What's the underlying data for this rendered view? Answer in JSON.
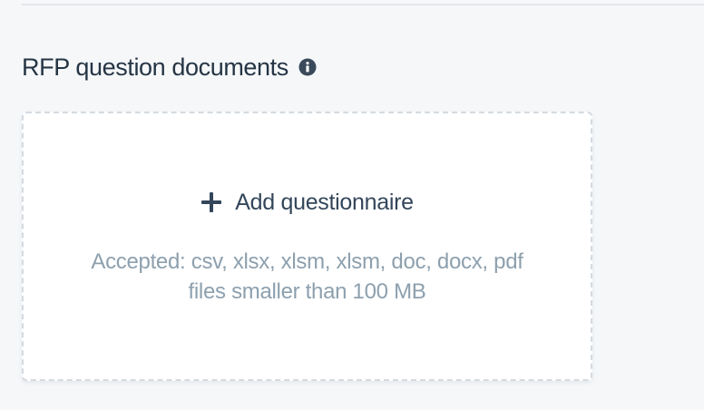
{
  "section": {
    "title": "RFP question documents",
    "info_icon": "info-circle-icon"
  },
  "dropzone": {
    "add_label": "Add questionnaire",
    "add_icon": "plus-icon",
    "accepted_line1": "Accepted: csv, xlsx, xlsm, xlsm, doc, docx, pdf",
    "accepted_line2": "files smaller than 100 MB"
  },
  "colors": {
    "page_background": "#f5f7f9",
    "title_text": "#253545",
    "hint_text": "#8da0ae",
    "dashed_border": "#d4dae0"
  }
}
